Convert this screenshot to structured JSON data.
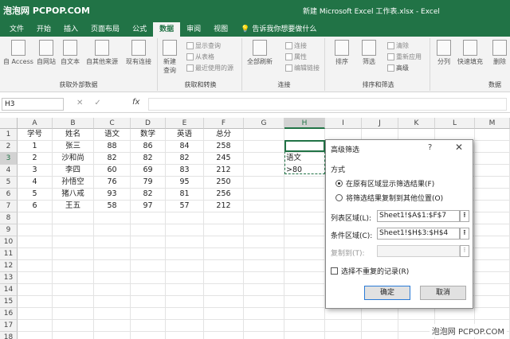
{
  "watermark": {
    "top_left": "泡泡网 PCPOP.COM",
    "bottom_right": "泡泡网 PCPOP.COM"
  },
  "window": {
    "title": "新建 Microsoft Excel 工作表.xlsx  -  Excel"
  },
  "ribbon_tabs": [
    "文件",
    "开始",
    "插入",
    "页面布局",
    "公式",
    "数据",
    "审阅",
    "视图"
  ],
  "active_tab": "数据",
  "tell_me": "告诉我你想要做什么",
  "ribbon": {
    "get_external": {
      "label": "获取外部数据",
      "buttons": [
        "自 Access",
        "自网站",
        "自文本",
        "自其他来源",
        "现有连接"
      ]
    },
    "get_transform": {
      "label": "获取和转换",
      "new_query": "新建\n查询",
      "items": [
        "显示查询",
        "从表格",
        "最近使用的源"
      ]
    },
    "connections": {
      "label": "连接",
      "refresh_all": "全部刷新",
      "items": [
        "连接",
        "属性",
        "编辑链接"
      ]
    },
    "sort_filter": {
      "label": "排序和筛选",
      "sort": "排序",
      "filter": "筛选",
      "items": [
        "清除",
        "重新应用",
        "高级"
      ]
    },
    "data_tools": {
      "label": "数据",
      "items": [
        "分列",
        "快速填充",
        "删除"
      ]
    }
  },
  "formula_bar": {
    "name_box": "H3",
    "fx": "fx"
  },
  "columns": [
    "A",
    "B",
    "C",
    "D",
    "E",
    "F",
    "G",
    "H",
    "I",
    "J",
    "K",
    "L",
    "M"
  ],
  "rows": [
    "1",
    "2",
    "3",
    "4",
    "5",
    "6",
    "7",
    "8",
    "9",
    "10",
    "11",
    "12",
    "13",
    "14",
    "15",
    "16",
    "17",
    "18"
  ],
  "table": {
    "headers": [
      "学号",
      "姓名",
      "语文",
      "数学",
      "英语",
      "总分"
    ],
    "rows": [
      [
        "1",
        "张三",
        "88",
        "86",
        "84",
        "258"
      ],
      [
        "2",
        "沙和尚",
        "82",
        "82",
        "82",
        "245"
      ],
      [
        "3",
        "李四",
        "60",
        "69",
        "83",
        "212"
      ],
      [
        "4",
        "孙悟空",
        "76",
        "79",
        "95",
        "250"
      ],
      [
        "5",
        "猪八戒",
        "93",
        "82",
        "81",
        "256"
      ],
      [
        "6",
        "王五",
        "58",
        "97",
        "57",
        "212"
      ]
    ]
  },
  "criteria": {
    "header": "语文",
    "value": ">80"
  },
  "dialog": {
    "title": "高级筛选",
    "help": "?",
    "close": "✕",
    "section": "方式",
    "radio1": "在原有区域显示筛选结果(F)",
    "radio2": "将筛选结果复制到其他位置(O)",
    "list_label": "列表区域(L):",
    "list_value": "Sheet1!$A$1:$F$7",
    "criteria_label": "条件区域(C):",
    "criteria_value": "Sheet1!$H$3:$H$4",
    "copy_label": "复制到(T):",
    "copy_value": "",
    "unique_label": "选择不重复的记录(R)",
    "ok": "确定",
    "cancel": "取消"
  }
}
